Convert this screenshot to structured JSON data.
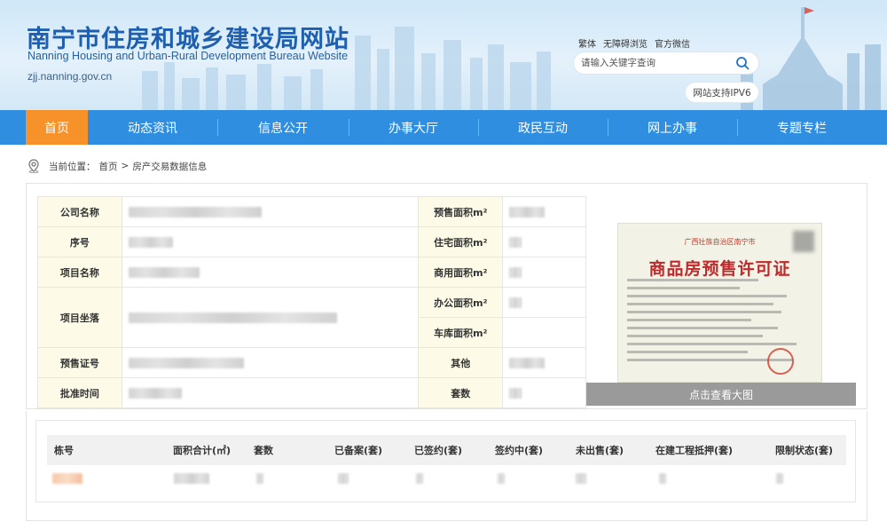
{
  "header": {
    "title": "南宁市住房和城乡建设局网站",
    "subtitle": "Nanning Housing and Urban-Rural Development Bureau Website",
    "domain": "zjj.nanning.gov.cn",
    "top_links": [
      "繁体",
      "无障碍浏览",
      "官方微信"
    ],
    "search_placeholder": "请输入关键字查询",
    "ipv6_badge": "网站支持IPV6"
  },
  "nav": {
    "items": [
      "首页",
      "动态资讯",
      "信息公开",
      "办事大厅",
      "政民互动",
      "网上办事",
      "专题专栏"
    ],
    "active_index": 0
  },
  "breadcrumb": {
    "prefix": "当前位置：",
    "home": "首页",
    "separator": ">",
    "current": "房产交易数据信息"
  },
  "info": {
    "left_labels": [
      "公司名称",
      "序号",
      "项目名称",
      "项目坐落",
      "预售证号",
      "批准时间"
    ],
    "right_labels": [
      "预售面积m²",
      "住宅面积m²",
      "商用面积m²",
      "办公面积m²",
      "车库面积m²",
      "其他",
      "套数"
    ]
  },
  "certificate": {
    "province": "广西壮族自治区南宁市",
    "title": "商品房预售许可证",
    "view_button": "点击查看大图"
  },
  "building_table": {
    "columns": [
      "栋号",
      "面积合计(㎡)",
      "套数",
      "已备案(套)",
      "已签约(套)",
      "签约中(套)",
      "未出售(套)",
      "在建工程抵押(套)",
      "限制状态(套)"
    ]
  },
  "colors": {
    "nav_bg": "#2f8ee0",
    "nav_active": "#f7922b",
    "title_blue": "#1f5fb0",
    "label_bg": "#fdfbe7",
    "cert_red": "#c0292b"
  }
}
